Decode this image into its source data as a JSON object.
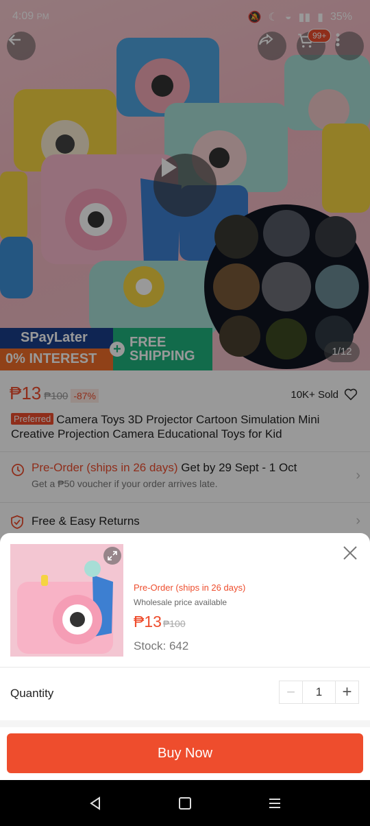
{
  "status_bar": {
    "time": "4:09",
    "ampm": "PM",
    "battery": "35%"
  },
  "cart": {
    "badge": "99+"
  },
  "hero": {
    "counter": "1/12",
    "promo": {
      "spaylater": "SPayLater",
      "interest": "0% INTEREST",
      "shipping_1": "FREE",
      "shipping_2": "SHIPPING"
    }
  },
  "product": {
    "price": "₱13",
    "old_price": "₱100",
    "discount": "-87%",
    "sold": "10K+ Sold",
    "preferred": "Preferred",
    "title": "Camera Toys 3D Projector Cartoon Simulation Mini Creative Projection Camera Educational Toys for Kid",
    "preorder": "Pre-Order (ships in 26 days)",
    "delivery": "Get by 29 Sept - 1 Oct",
    "voucher": "Get a ₱50 voucher if your order arrives late.",
    "returns": "Free & Easy Returns"
  },
  "sheet": {
    "preorder": "Pre-Order (ships in 26 days)",
    "wholesale": "Wholesale price available",
    "price": "₱13",
    "old_price": "₱100",
    "stock": "Stock: 642",
    "quantity_label": "Quantity",
    "minus": "−",
    "quantity": "1",
    "plus": "+",
    "buy_now": "Buy Now"
  },
  "colors": {
    "accent": "#ee4d2d",
    "shipping_green": "#1fb27d",
    "spay_blue": "#1a3f8a"
  }
}
